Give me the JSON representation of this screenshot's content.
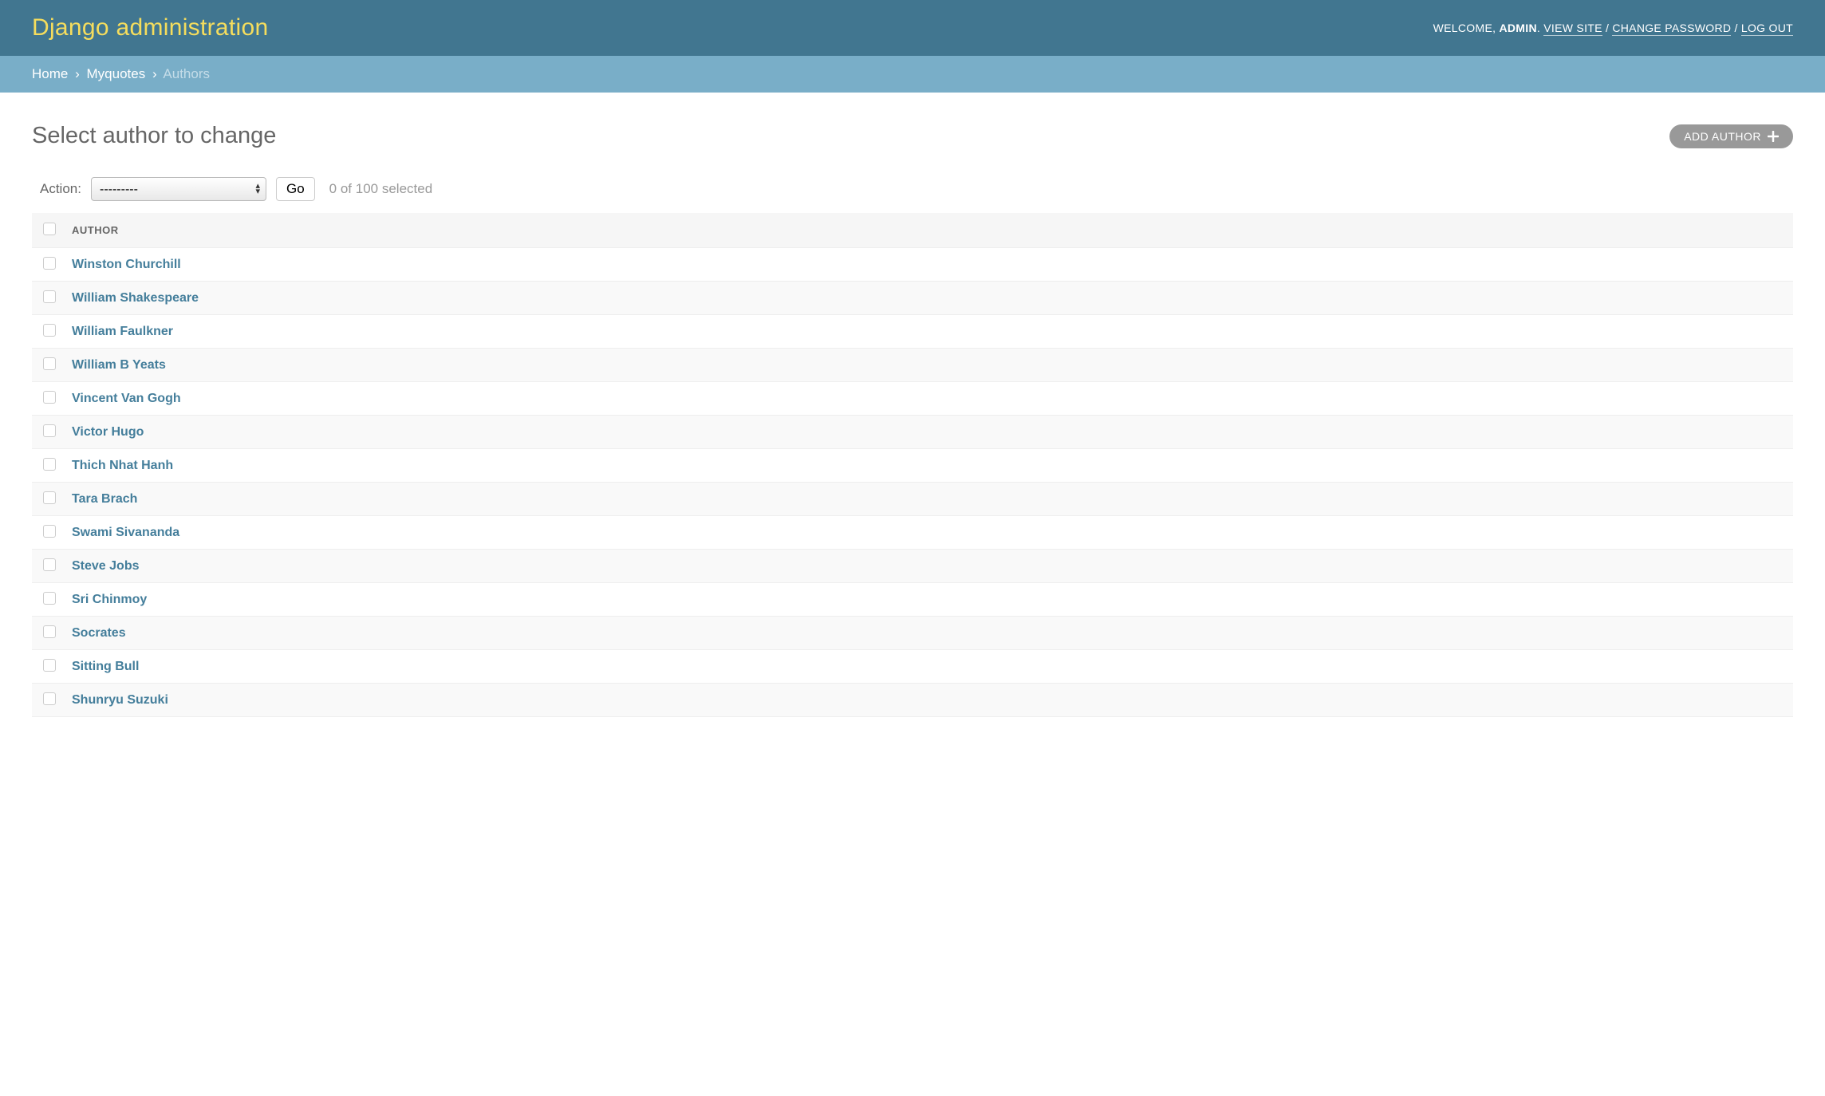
{
  "header": {
    "branding": "Django administration",
    "welcome": "WELCOME,",
    "user": "ADMIN",
    "view_site": "VIEW SITE",
    "change_password": "CHANGE PASSWORD",
    "log_out": "LOG OUT"
  },
  "breadcrumbs": {
    "home": "Home",
    "app": "Myquotes",
    "model": "Authors"
  },
  "content": {
    "title": "Select author to change",
    "add_button": "ADD AUTHOR"
  },
  "actions": {
    "label": "Action:",
    "placeholder": "---------",
    "go": "Go",
    "counter": "0 of 100 selected"
  },
  "table": {
    "header": "AUTHOR",
    "rows": [
      {
        "name": "Winston Churchill"
      },
      {
        "name": "William Shakespeare"
      },
      {
        "name": "William Faulkner"
      },
      {
        "name": "William B Yeats"
      },
      {
        "name": "Vincent Van Gogh"
      },
      {
        "name": "Victor Hugo"
      },
      {
        "name": "Thich Nhat Hanh"
      },
      {
        "name": "Tara Brach"
      },
      {
        "name": "Swami Sivananda"
      },
      {
        "name": "Steve Jobs"
      },
      {
        "name": "Sri Chinmoy"
      },
      {
        "name": "Socrates"
      },
      {
        "name": "Sitting Bull"
      },
      {
        "name": "Shunryu Suzuki"
      }
    ]
  }
}
